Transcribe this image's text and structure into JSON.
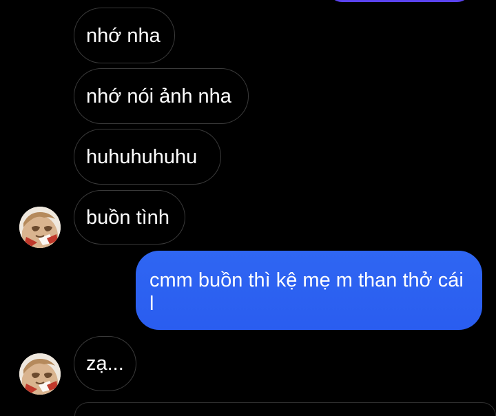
{
  "conversation": {
    "messages": [
      {
        "sender": "other",
        "text": "nhớ nha"
      },
      {
        "sender": "other",
        "text": "nhớ nói ảnh nha"
      },
      {
        "sender": "other",
        "text": "huhuhuhuhu"
      },
      {
        "sender": "other",
        "text": "buồn tình"
      },
      {
        "sender": "me",
        "text": "cmm buồn thì kệ mẹ m than thở cái l"
      },
      {
        "sender": "other",
        "text": "zạ..."
      }
    ],
    "avatar_icon": "contact-avatar-icon"
  },
  "colors": {
    "background": "#000000",
    "incoming_border": "#3a3a3a",
    "outgoing_bubble": "#2f66f2",
    "previous_outgoing_bubble": "#5a43f0",
    "text": "#ffffff"
  }
}
